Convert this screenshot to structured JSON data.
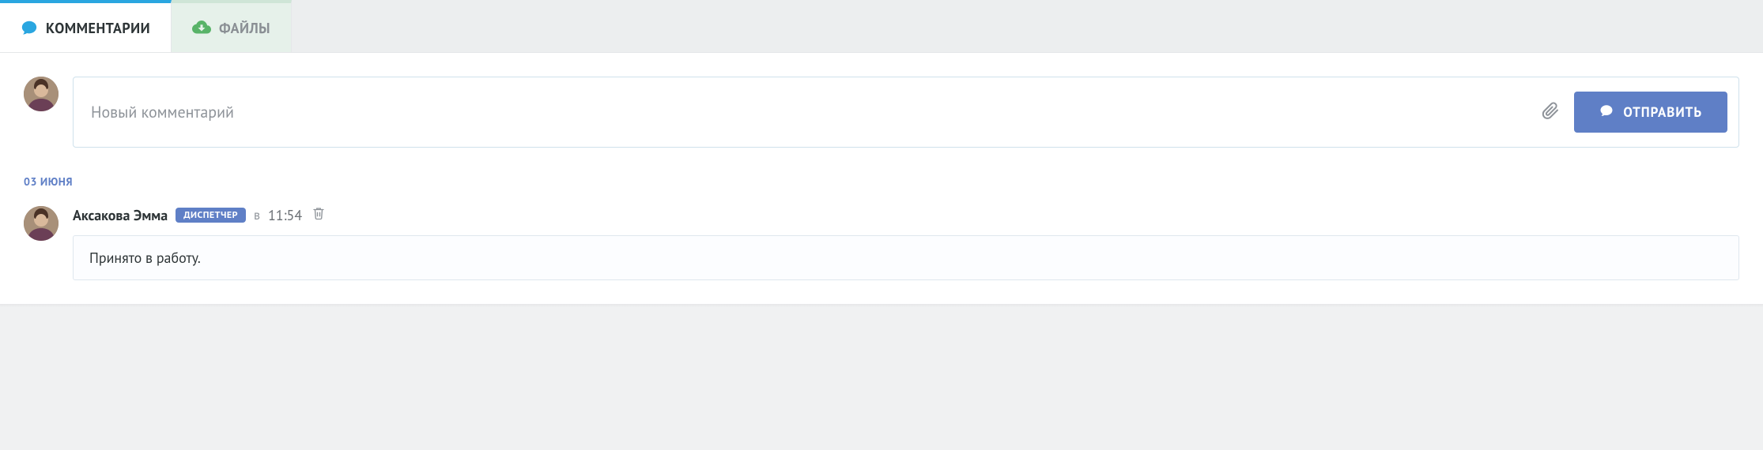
{
  "tabs": {
    "comments": {
      "label": "КОММЕНТАРИИ",
      "icon": "speech-bubble-icon"
    },
    "files": {
      "label": "ФАЙЛЫ",
      "icon": "cloud-download-icon"
    }
  },
  "composer": {
    "placeholder": "Новый комментарий",
    "attach_icon": "paperclip-icon",
    "send_icon": "speech-bubble-icon",
    "send_label": "ОТПРАВИТЬ"
  },
  "feed": {
    "date_separator": "03 ИЮНЯ",
    "comments": [
      {
        "author": "Аксакова Эмма",
        "role": "ДИСПЕТЧЕР",
        "time_prefix": "в",
        "time": "11:54",
        "delete_icon": "trash-icon",
        "text": "Принято в работу."
      }
    ]
  },
  "colors": {
    "accent_blue": "#2aa6e0",
    "brand_blue": "#5f7fc6",
    "files_green": "#58b368"
  }
}
